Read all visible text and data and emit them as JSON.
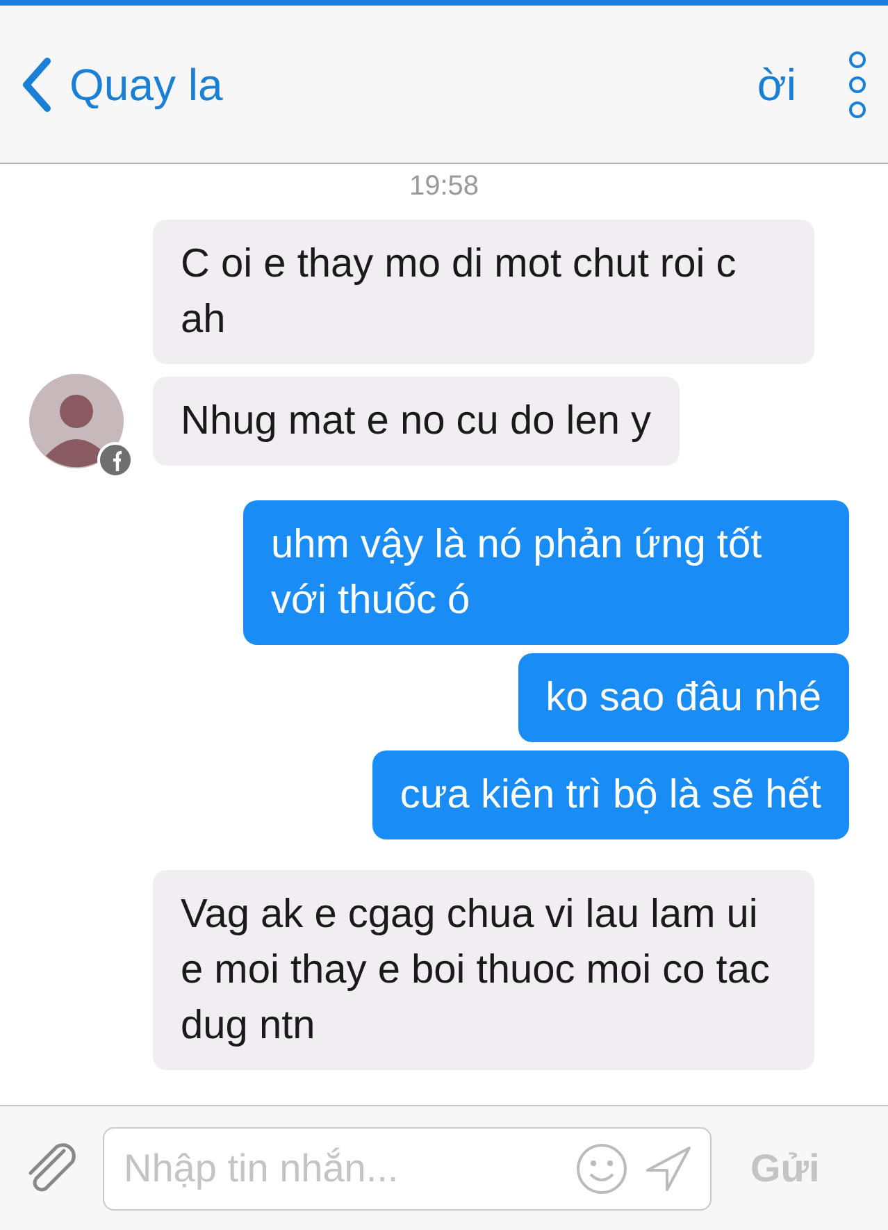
{
  "header": {
    "back_label": "Quay la",
    "title_fragment": "ời"
  },
  "timestamp": "19:58",
  "messages": [
    {
      "kind": "incoming",
      "avatar": false,
      "text": "C oi e thay mo di mot chut roi c ah"
    },
    {
      "kind": "incoming",
      "avatar": true,
      "text": "Nhug mat e no cu do len y"
    },
    {
      "kind": "outgoing",
      "avatar": false,
      "text": "uhm vậy là nó phản ứng tốt với thuốc ó"
    },
    {
      "kind": "outgoing",
      "avatar": false,
      "text": "ko sao đâu nhé"
    },
    {
      "kind": "outgoing",
      "avatar": false,
      "text": "cưa kiên trì bộ là sẽ hết"
    },
    {
      "kind": "incoming",
      "avatar": false,
      "text": "Vag ak e cgag chua vi lau lam ui e moi thay e boi thuoc moi co tac dug ntn"
    }
  ],
  "composer": {
    "placeholder": "Nhập tin nhắn...",
    "send_label": "Gửi"
  }
}
